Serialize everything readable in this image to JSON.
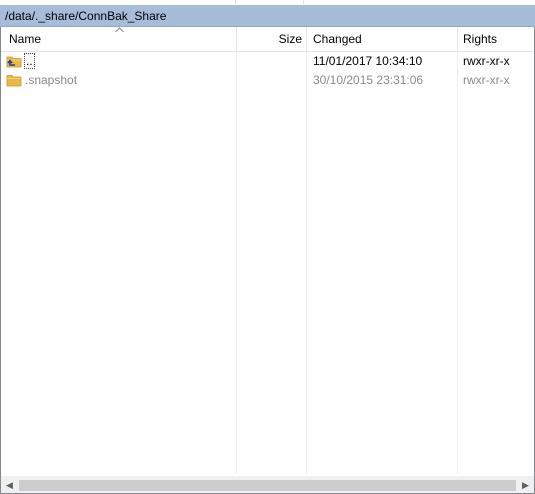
{
  "window": {
    "path": "/data/._share/ConnBak_Share"
  },
  "columns": {
    "name": "Name",
    "size": "Size",
    "changed": "Changed",
    "rights": "Rights"
  },
  "rows": [
    {
      "icon": "parent-folder-icon",
      "name": "..",
      "size": "",
      "changed": "11/01/2017 10:34:10",
      "rights": "rwxr-xr-x"
    },
    {
      "icon": "folder-icon",
      "name": ".snapshot",
      "size": "",
      "changed": "30/10/2015 23:31:06",
      "rights": "rwxr-xr-x"
    }
  ],
  "colors": {
    "path_bar": "#a7bcd8",
    "folder": "#e8b84a",
    "hidden_text": "#8a8a8a"
  }
}
